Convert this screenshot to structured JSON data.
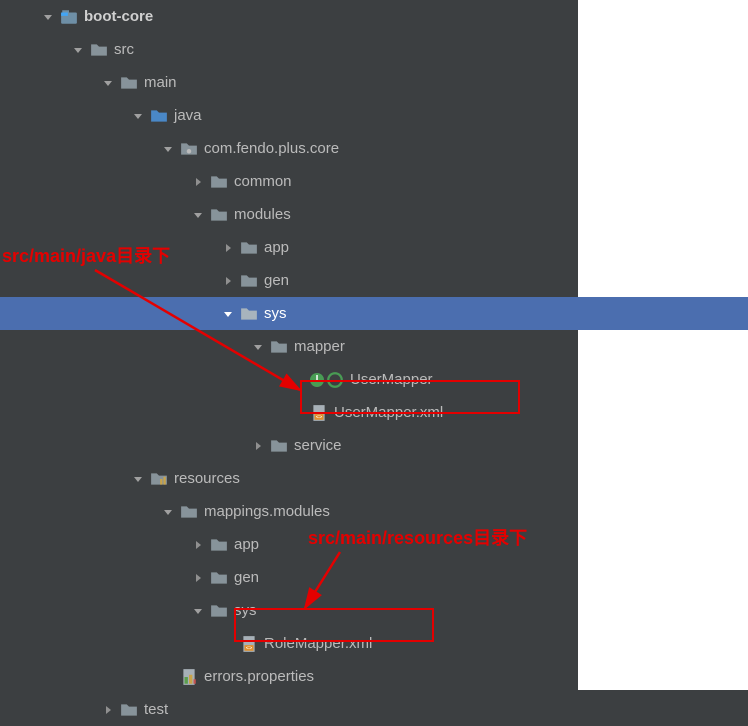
{
  "tree": {
    "root": "boot-core",
    "src": "src",
    "main": "main",
    "java": "java",
    "pkg": "com.fendo.plus.core",
    "common": "common",
    "modules": "modules",
    "app": "app",
    "gen": "gen",
    "sys": "sys",
    "mapper": "mapper",
    "userMapper": "UserMapper",
    "userMapperXml": "UserMapper.xml",
    "service": "service",
    "resources": "resources",
    "mappingsModules": "mappings.modules",
    "r_app": "app",
    "r_gen": "gen",
    "r_sys": "sys",
    "roleMapperXml": "RoleMapper.xml",
    "errorsProps": "errors.properties",
    "test": "test"
  },
  "annotations": {
    "javaDir": "src/main/java目录下",
    "resourcesDir": "src/main/resources目录下"
  },
  "colors": {
    "selection": "#4b6eaf",
    "bg": "#3c3f41",
    "red": "#e40000"
  }
}
